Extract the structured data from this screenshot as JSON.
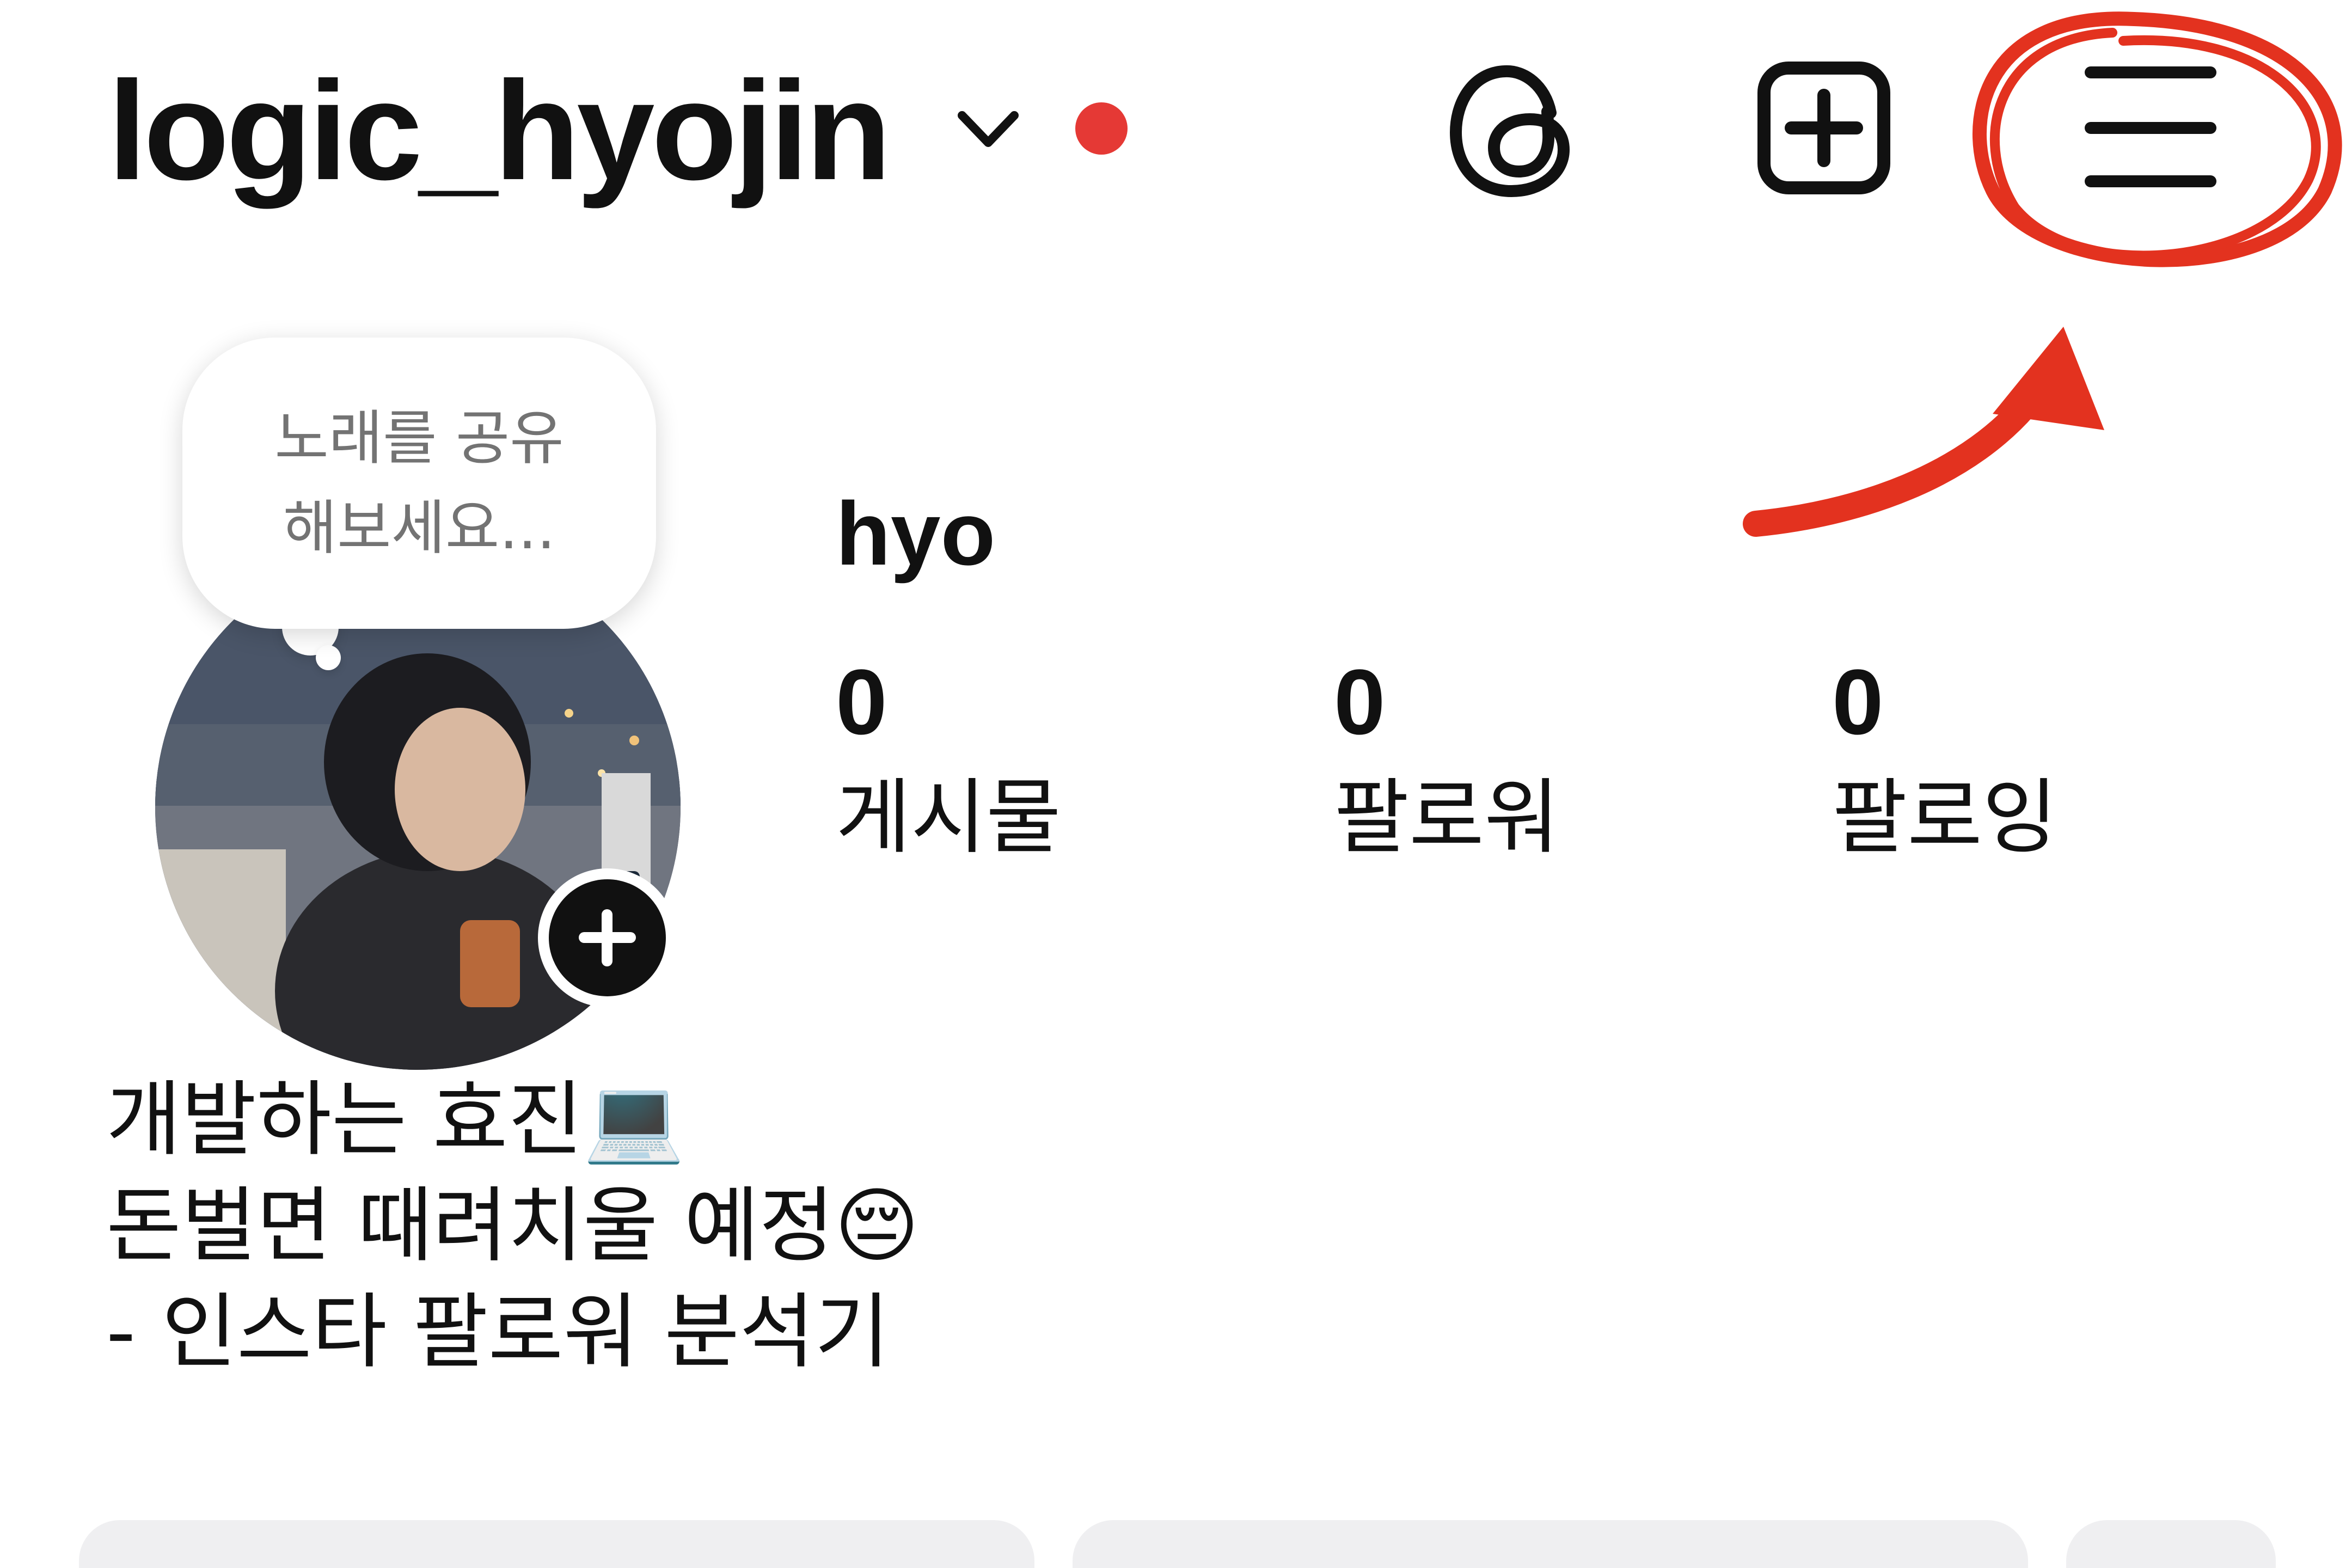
{
  "header": {
    "username": "logic_hyojin",
    "chevron_icon": "chevron-down-icon",
    "notification_color": "#e53935",
    "threads_icon": "threads-icon",
    "create_icon": "plus-square-icon",
    "menu_icon": "hamburger-menu-icon"
  },
  "annotation": {
    "color": "#e3321f",
    "target": "menu-button"
  },
  "note": {
    "text": "노래를 공유\n해보세요..."
  },
  "profile": {
    "display_name": "hyo",
    "avatar_icon": "profile-photo",
    "add_story_icon": "plus-icon"
  },
  "stats": {
    "posts": {
      "count": "0",
      "label": "게시물"
    },
    "followers": {
      "count": "0",
      "label": "팔로워"
    },
    "following": {
      "count": "0",
      "label": "팔로잉"
    }
  },
  "bio": {
    "lines": [
      "개발하는 효진💻",
      "돈벌면 때려치울 예정😔",
      "- 인스타 팔로워 분석기"
    ]
  }
}
